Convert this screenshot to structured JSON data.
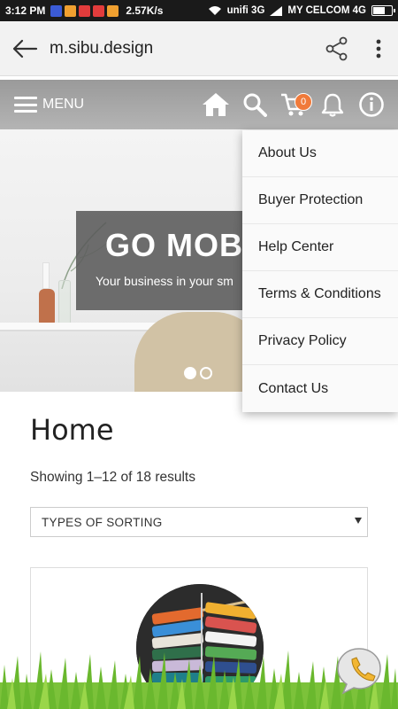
{
  "status_bar": {
    "time": "3:12 PM",
    "network_speed": "2.57K/s",
    "carrier_1": "unifi 3G",
    "carrier_2": "MY CELCOM 4G",
    "notification_colors": [
      "#3b5bd6",
      "#f0a030",
      "#e23c3c",
      "#e23c3c",
      "#f0a030"
    ]
  },
  "browser": {
    "url": "m.sibu.design"
  },
  "site_header": {
    "menu_label": "MENU",
    "cart_count": "0",
    "accent_color": "#f07a3a"
  },
  "hero": {
    "title": "GO MOBI",
    "subtitle": "Your business in your sm",
    "slide_count": 2,
    "active_slide": 1
  },
  "dropdown_menu": {
    "items": [
      {
        "label": "About Us"
      },
      {
        "label": "Buyer Protection"
      },
      {
        "label": "Help Center"
      },
      {
        "label": "Terms & Conditions"
      },
      {
        "label": "Privacy Policy"
      },
      {
        "label": "Contact Us"
      }
    ]
  },
  "content": {
    "page_title": "Home",
    "result_count": "Showing 1–12 of 18 results",
    "sort_select": {
      "selected": "TYPES OF SORTING"
    }
  },
  "icons": {
    "back": "back-arrow-icon",
    "share": "share-icon",
    "more": "more-vert-icon",
    "home": "home-icon",
    "search": "search-icon",
    "cart": "cart-icon",
    "notifications": "bell-icon",
    "info": "info-icon",
    "chat": "phone-chat-icon"
  }
}
